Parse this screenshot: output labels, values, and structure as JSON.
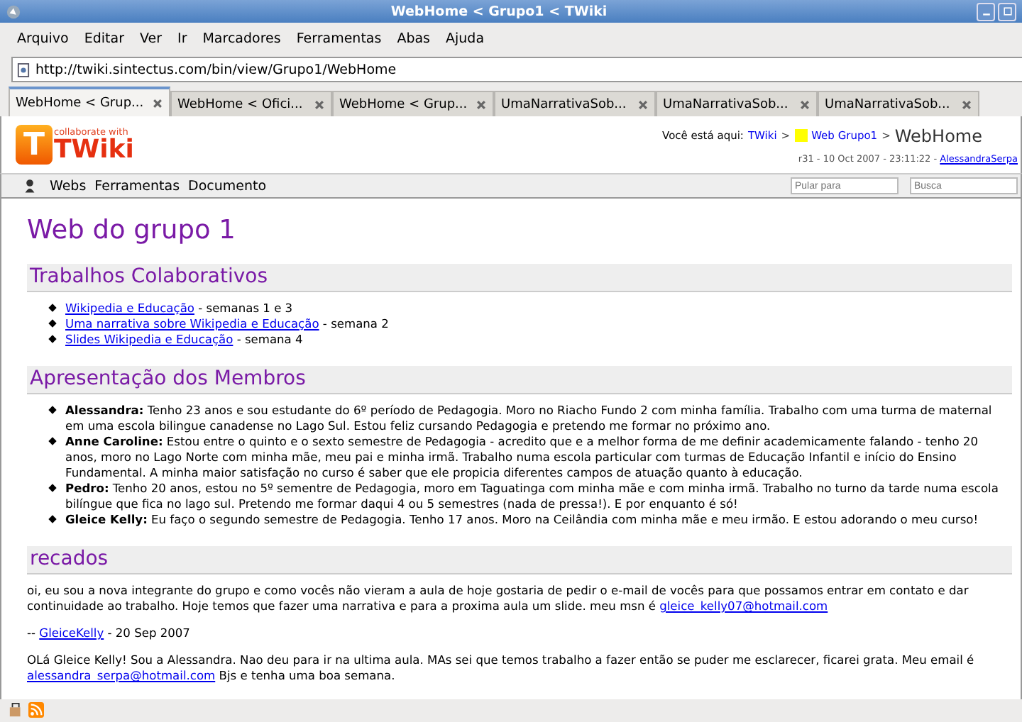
{
  "window": {
    "title": "WebHome < Grupo1 < TWiki"
  },
  "menu": [
    "Arquivo",
    "Editar",
    "Ver",
    "Ir",
    "Marcadores",
    "Ferramentas",
    "Abas",
    "Ajuda"
  ],
  "address": {
    "value": "http://twiki.sintectus.com/bin/view/Grupo1/WebHome"
  },
  "tabs": [
    {
      "label": "WebHome < Grup...",
      "selected": true
    },
    {
      "label": "WebHome < Ofici...",
      "selected": false
    },
    {
      "label": "WebHome < Grup...",
      "selected": false
    },
    {
      "label": "UmaNarrativaSob...",
      "selected": false
    },
    {
      "label": "UmaNarrativaSob...",
      "selected": false
    },
    {
      "label": "UmaNarrativaSob...",
      "selected": false
    }
  ],
  "header": {
    "logo_tagline": "collaborate with",
    "logo_word": "TWiki",
    "logo_letter": "T",
    "breadcrumb_label": "Você está aqui:",
    "crumbs": [
      "TWiki",
      "Web Grupo1"
    ],
    "separators": [
      ">",
      ">"
    ],
    "current": "WebHome",
    "revision": "r31 - 10 Oct 2007 - 23:11:22 - ",
    "author": "AlessandraSerpa"
  },
  "nav": {
    "items": [
      "Webs",
      "Ferramentas",
      "Documento"
    ],
    "jump": {
      "placeholder": "Pular para"
    },
    "search": {
      "placeholder": "Busca"
    }
  },
  "page_title": "Web do grupo 1",
  "sections": [
    {
      "title": "Trabalhos Colaborativos",
      "kind": "links",
      "items": [
        {
          "link": "Wikipedia e Educação",
          "text": " - semanas 1 e 3"
        },
        {
          "link": "Uma narrativa sobre Wikipedia e Educação",
          "text": " - semana 2"
        },
        {
          "link": "Slides Wikipedia e Educação",
          "text": " - semana 4"
        }
      ]
    },
    {
      "title": "Apresentação dos Membros",
      "kind": "members",
      "items": [
        {
          "text": "**Alessandra:** Tenho 23 anos e sou estudante do 6º período de Pedagogia. Moro no Riacho Fundo 2 com minha família. Trabalho com uma turma de maternal em uma escola bilingue canadense no Lago Sul. Estou feliz cursando Pedagogia e pretendo me formar no próximo ano."
        },
        {
          "text": "**Anne Caroline:** Estou entre o quinto e o sexto semestre de Pedagogia - acredito que e a melhor forma de me definir academicamente falando - tenho 20 anos, moro no Lago Norte com minha mãe, meu pai e minha irmã. Trabalho numa escola particular com turmas de Educação Infantil e início do Ensino Fundamental. A minha maior satisfação no curso é saber que ele propicia diferentes campos de atuação quanto à educação."
        },
        {
          "text": "**Pedro:** Tenho 20 anos, estou no 5º sementre de Pedagogia, moro em Taguatinga com minha mãe e com minha irmã. Trabalho no turno da tarde numa escola bilíngue que fica no lago sul. Pretendo me formar daqui 4 ou 5 semestres (nada de pressa!). E por enquanto é só!"
        },
        {
          "text": "**Gleice Kelly:** Eu faço o segundo semestre de Pedagogia. Tenho 17 anos. Moro na Ceilândia com minha mãe e meu irmão. E estou adorando o meu curso!"
        }
      ]
    },
    {
      "title": "recados",
      "kind": "messages",
      "items": [
        {
          "segments": [
            {
              "kind": "text",
              "text": "oi, eu sou a nova integrante do grupo e como vocês não vieram a aula de hoje gostaria de pedir o e-mail de vocês para que possamos entrar em contato e dar continuidade ao trabalho. Hoje temos que fazer uma narrativa e para a proxima aula um slide. meu msn é "
            },
            {
              "kind": "link",
              "text": "gleice_kelly07@hotmail.com"
            }
          ]
        },
        {
          "segments": [
            {
              "kind": "text",
              "text": "-- "
            },
            {
              "kind": "link",
              "text": "GleiceKelly"
            },
            {
              "kind": "text",
              "text": " - 20 Sep 2007"
            }
          ]
        },
        {
          "segments": [
            {
              "kind": "text",
              "text": "OLá Gleice Kelly! Sou a Alessandra. Nao deu para ir na ultima aula. MAs sei que temos trabalho a fazer então se puder me esclarecer, ficarei grata. Meu email é "
            },
            {
              "kind": "link",
              "text": "alessandra_serpa@hotmail.com"
            },
            {
              "kind": "text",
              "text": " Bjs e tenha uma boa semana."
            }
          ]
        }
      ]
    }
  ]
}
